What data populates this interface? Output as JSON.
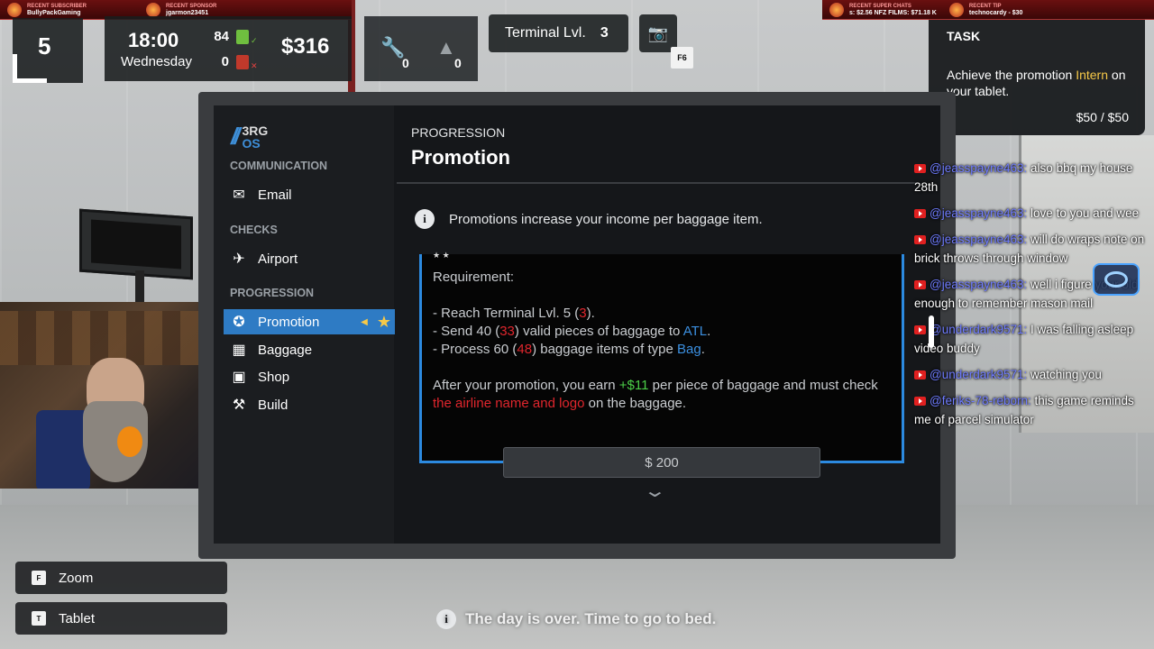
{
  "stream": {
    "recent_subscriber_label": "RECENT SUBSCRIBER",
    "recent_subscriber": "BullyPackGaming",
    "recent_sponsor_label": "RECENT SPONSOR",
    "recent_sponsor": "jgarmon23451",
    "recent_super_chats_label": "RECENT SUPER CHATS",
    "super_chats_value": "s: $2.56   NFZ FILMS: $71.18   K",
    "recent_tip_label": "RECENT TIP",
    "recent_tip": "technocardy - $30"
  },
  "hud": {
    "day": "5",
    "time": "18:00",
    "weekday": "Wednesday",
    "bags_ok": "84",
    "bags_bad": "0",
    "money": "$316",
    "wrench_count": "0",
    "tree_count": "0",
    "terminal_label": "Terminal Lvl.",
    "terminal_level": "3",
    "camera_key": "F6"
  },
  "task": {
    "title": "TASK",
    "text_before": "Achieve the promotion ",
    "highlight": "Intern",
    "text_after": " on your tablet.",
    "progress": "$50 / $50"
  },
  "tablet": {
    "logo_top": "3RG",
    "logo_bottom": "OS",
    "sections": {
      "communication": "COMMUNICATION",
      "checks": "CHECKS",
      "progression": "PROGRESSION"
    },
    "items": {
      "email": "Email",
      "airport": "Airport",
      "promotion": "Promotion",
      "baggage": "Baggage",
      "shop": "Shop",
      "build": "Build"
    },
    "page_subtitle": "PROGRESSION",
    "page_title": "Promotion",
    "info_text": "Promotions increase your income per baggage item.",
    "card": {
      "stars": "★ ★",
      "requirement_label": "Requirement:",
      "r1_pre": "- Reach Terminal Lvl. 5 (",
      "r1_val": "3",
      "r1_post": ").",
      "r2_pre": "- Send 40 (",
      "r2_val": "33",
      "r2_mid": ") valid pieces of baggage to ",
      "r2_dest": "ATL",
      "r2_post": ".",
      "r3_pre": "- Process 60 (",
      "r3_val": "48",
      "r3_mid": ") baggage items of type ",
      "r3_type": "Bag",
      "r3_post": ".",
      "after_pre": "After your promotion, you earn ",
      "after_amount": "+$11",
      "after_mid": " per piece of baggage and must check ",
      "after_red": "the airline name and logo",
      "after_post": " on the baggage."
    },
    "price_button": "$ 200"
  },
  "chat": [
    {
      "user": "@jeasspayne463:",
      "text": "also bbq my house 28th"
    },
    {
      "user": "@jeasspayne463:",
      "text": "love to you and wee"
    },
    {
      "user": "@jeasspayne463:",
      "text": "will do wraps note on brick throws through window"
    },
    {
      "user": "@jeasspayne463:",
      "text": "well i figure your old enough to remember mason mail"
    },
    {
      "user": "@underdark9571:",
      "text": "I was falling asleep video buddy"
    },
    {
      "user": "@underdark9571:",
      "text": "watching you"
    },
    {
      "user": "@feriks-78-reborn:",
      "text": "this game reminds me of parcel simulator"
    }
  ],
  "hints": {
    "zoom_key": "F",
    "zoom_label": "Zoom",
    "tablet_key": "T",
    "tablet_label": "Tablet"
  },
  "notice": "The day is over. Time to go to bed.",
  "colors": {
    "accent_blue": "#2e7bc4",
    "highlight_yellow": "#f7c948",
    "requirement_red": "#e0262d",
    "income_green": "#4ccf48"
  }
}
